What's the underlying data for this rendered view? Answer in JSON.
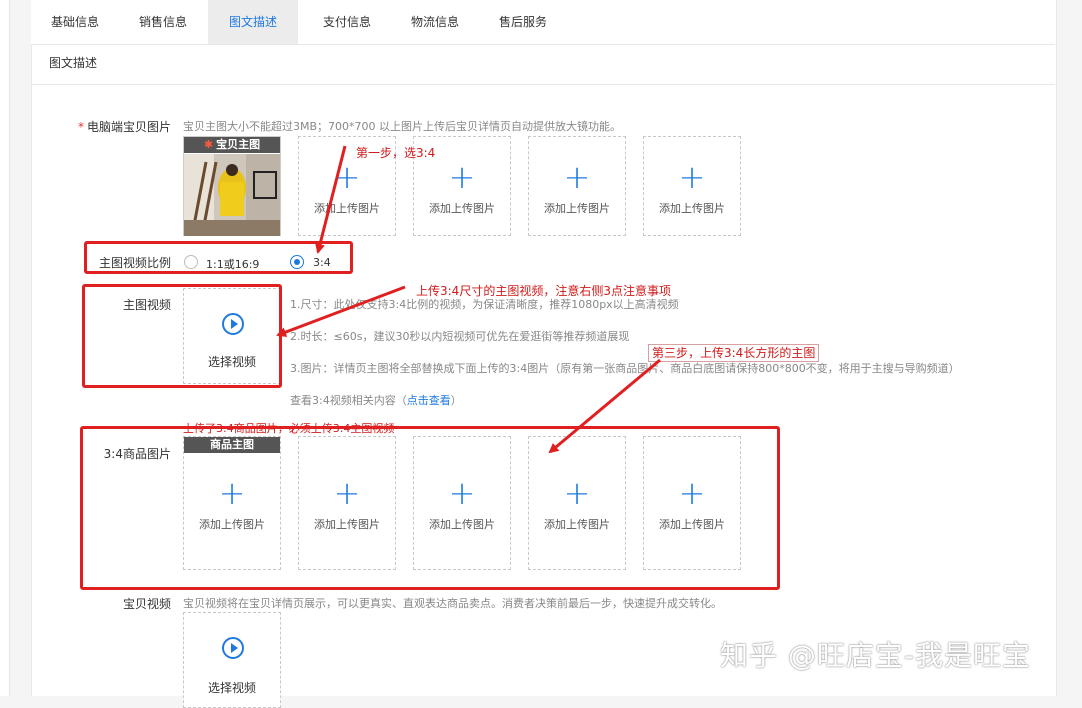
{
  "tabs": [
    "基础信息",
    "销售信息",
    "图文描述",
    "支付信息",
    "物流信息",
    "售后服务"
  ],
  "active_tab": "图文描述",
  "section_title": "图文描述",
  "pc_images": {
    "required_mark": "*",
    "label": "电脑端宝贝图片",
    "hint": "宝贝主图大小不能超过3MB；700*700 以上图片上传后宝贝详情页自动提供放大镜功能。",
    "main_tag": "宝贝主图",
    "slot_label": "添加上传图片"
  },
  "ratio": {
    "label": "主图视频比例",
    "option1": "1:1或16:9",
    "option2": "3:4",
    "selected": "3:4"
  },
  "main_video": {
    "label": "主图视频",
    "button": "选择视频",
    "notes": [
      "1.尺寸：此处仅支持3:4比例的视频，为保证清晰度，推荐1080px以上高清视频",
      "2.时长：≤60s，建议30秒以内短视频可优先在爱逛街等推荐频道展现",
      "3.图片：详情页主图将全部替换成下面上传的3:4图片（原有第一张商品图片、商品白底图请保持800*800不变，将用于主搜与导购频道）"
    ],
    "more_prefix": "查看3:4视频相关内容（",
    "more_link": "点击查看",
    "more_suffix": "）"
  },
  "product_34": {
    "label": "3:4商品图片",
    "warning": "上传了3:4商品图片，必须上传3:4主图视频",
    "main_tag": "商品主图",
    "slot_label": "添加上传图片"
  },
  "item_video": {
    "label": "宝贝视频",
    "hint": "宝贝视频将在宝贝详情页展示，可以更真实、直观表达商品卖点。消费者决策前最后一步，快速提升成交转化。",
    "button": "选择视频"
  },
  "annotations": {
    "step1": "第一步，选3:4",
    "step2": "上传3:4尺寸的主图视频，注意右侧3点注意事项",
    "step3": "第三步，上传3:4长方形的主图"
  },
  "watermark": "知乎 @旺店宝-我是旺宝",
  "colors": {
    "accent": "#1f7ae0",
    "annotation": "#e02020"
  },
  "icons": {
    "upload": "plus-icon",
    "video": "play-circle-icon"
  }
}
